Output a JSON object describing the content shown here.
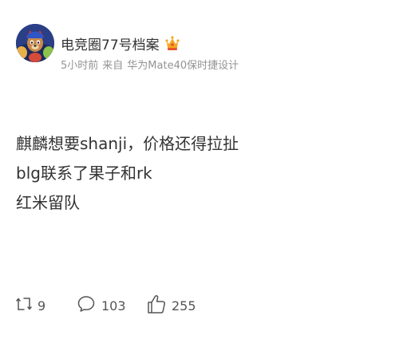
{
  "author": {
    "name": "电竞圈77号档案",
    "verified_badge": "crown-icon"
  },
  "post_meta": {
    "time": "5小时前",
    "source_prefix": "来自",
    "device": "华为Mate40保时捷设计"
  },
  "content": {
    "lines": [
      "麒麟想要shanji，价格还得拉扯",
      "blg联系了果子和rk",
      "红米留队"
    ]
  },
  "actions": {
    "repost": {
      "icon": "repost-icon",
      "count": "9"
    },
    "comment": {
      "icon": "comment-icon",
      "count": "103"
    },
    "like": {
      "icon": "thumbs-up-icon",
      "count": "255"
    }
  },
  "colors": {
    "text_primary": "#333333",
    "text_secondary": "#939393",
    "icon_gray": "#555555",
    "crown_gold": "#f5a623",
    "crown_red": "#e8542f"
  }
}
